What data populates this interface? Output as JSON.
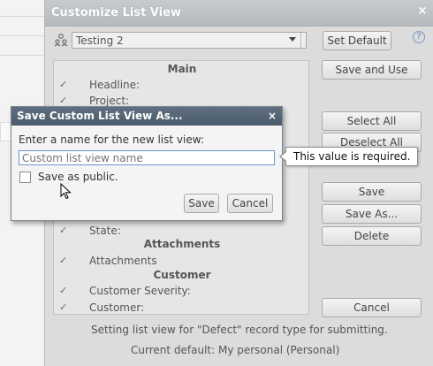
{
  "dialog": {
    "title": "Customize List View",
    "close": "×",
    "owner_select": "Testing 2",
    "help": "?",
    "buttons": {
      "set_default": "Set Default",
      "save_and_use": "Save and Use",
      "select_all": "Select All",
      "deselect_all": "Deselect All",
      "save": "Save",
      "save_as": "Save As...",
      "delete": "Delete",
      "cancel": "Cancel"
    },
    "sections": [
      {
        "heading": "Main",
        "rows": [
          {
            "label": "Headline:",
            "checked": true
          },
          {
            "label": "Project:",
            "checked": true
          }
        ]
      },
      {
        "heading": "",
        "rows": [
          {
            "label": "State:",
            "checked": true
          }
        ]
      },
      {
        "heading": "Attachments",
        "rows": [
          {
            "label": "Attachments",
            "checked": true
          }
        ]
      },
      {
        "heading": "Customer",
        "rows": [
          {
            "label": "Customer Severity:",
            "checked": true
          },
          {
            "label": "Customer:",
            "checked": true
          }
        ]
      }
    ],
    "check_mark": "✓",
    "footer_line1": "Setting list view for \"Defect\" record type for submitting.",
    "footer_line2": "Current default: My personal (Personal)"
  },
  "save_dialog": {
    "title": "Save Custom List View As...",
    "close": "×",
    "prompt": "Enter a name for the new list view:",
    "input_placeholder": "Custom list view name",
    "input_value": "",
    "public_label": "Save as public.",
    "public_checked": false,
    "save_label": "Save",
    "cancel_label": "Cancel"
  },
  "tooltip": {
    "text": "This value is required."
  },
  "icons": {
    "owner": "people-icon",
    "help": "help-icon",
    "cursor": "mouse-pointer-icon"
  },
  "colors": {
    "title_bar": "#b5babf",
    "save_title_bar": "#4a5b6b",
    "input_border": "#6a94c8"
  }
}
